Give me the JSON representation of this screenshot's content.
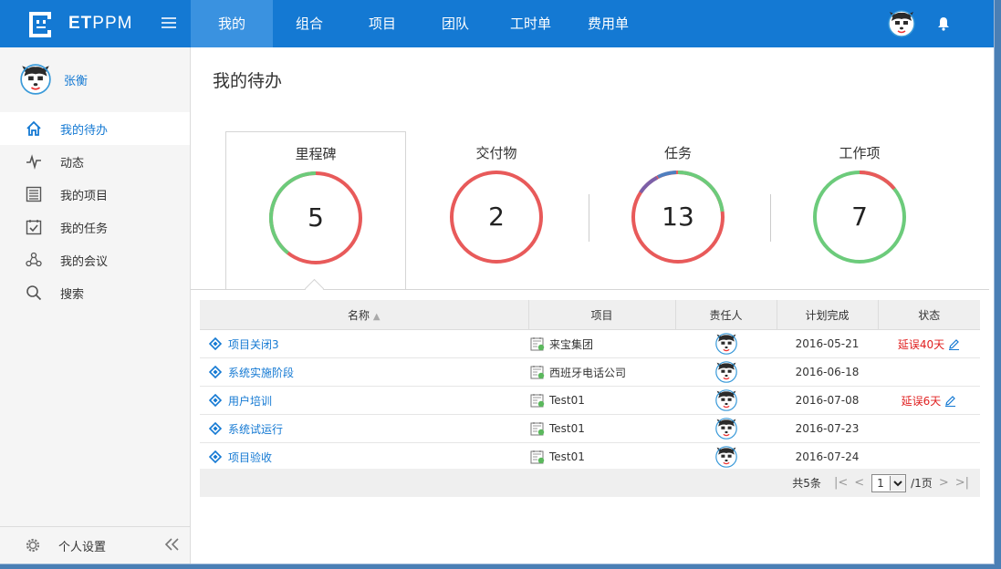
{
  "app": {
    "logo_bold": "ET",
    "logo_rest": "PPM"
  },
  "nav": {
    "items": [
      {
        "label": "我的",
        "active": true
      },
      {
        "label": "组合"
      },
      {
        "label": "项目"
      },
      {
        "label": "团队"
      },
      {
        "label": "工时单"
      },
      {
        "label": "费用单"
      }
    ]
  },
  "user": {
    "name": "张衡"
  },
  "sidebar": {
    "items": [
      {
        "label": "我的待办",
        "icon": "home-icon",
        "active": true
      },
      {
        "label": "动态",
        "icon": "activity-icon"
      },
      {
        "label": "我的项目",
        "icon": "project-list-icon"
      },
      {
        "label": "我的任务",
        "icon": "task-icon"
      },
      {
        "label": "我的会议",
        "icon": "meeting-icon"
      },
      {
        "label": "搜索",
        "icon": "search-icon"
      }
    ],
    "settings_label": "个人设置"
  },
  "page_title": "我的待办",
  "stats": [
    {
      "label": "里程碑",
      "value": "5"
    },
    {
      "label": "交付物",
      "value": "2"
    },
    {
      "label": "任务",
      "value": "13"
    },
    {
      "label": "工作项",
      "value": "7"
    }
  ],
  "table": {
    "headers": [
      "名称",
      "项目",
      "责任人",
      "计划完成",
      "状态"
    ],
    "rows": [
      {
        "name": "项目关闭3",
        "project": "来宝集团",
        "date": "2016-05-21",
        "status": "延误40天"
      },
      {
        "name": "系统实施阶段",
        "project": "西班牙电话公司",
        "date": "2016-06-18",
        "status": ""
      },
      {
        "name": "用户培训",
        "project": "Test01",
        "date": "2016-07-08",
        "status": "延误6天"
      },
      {
        "name": "系统试运行",
        "project": "Test01",
        "date": "2016-07-23",
        "status": ""
      },
      {
        "name": "项目验收",
        "project": "Test01",
        "date": "2016-07-24",
        "status": ""
      }
    ]
  },
  "pager": {
    "total": "共5条",
    "page": "1",
    "pages": "/1页"
  },
  "colors": {
    "brand": "#1479d3",
    "ring_green": "#6ccb7b",
    "ring_red": "#e85a5a",
    "delay": "#e02020"
  }
}
